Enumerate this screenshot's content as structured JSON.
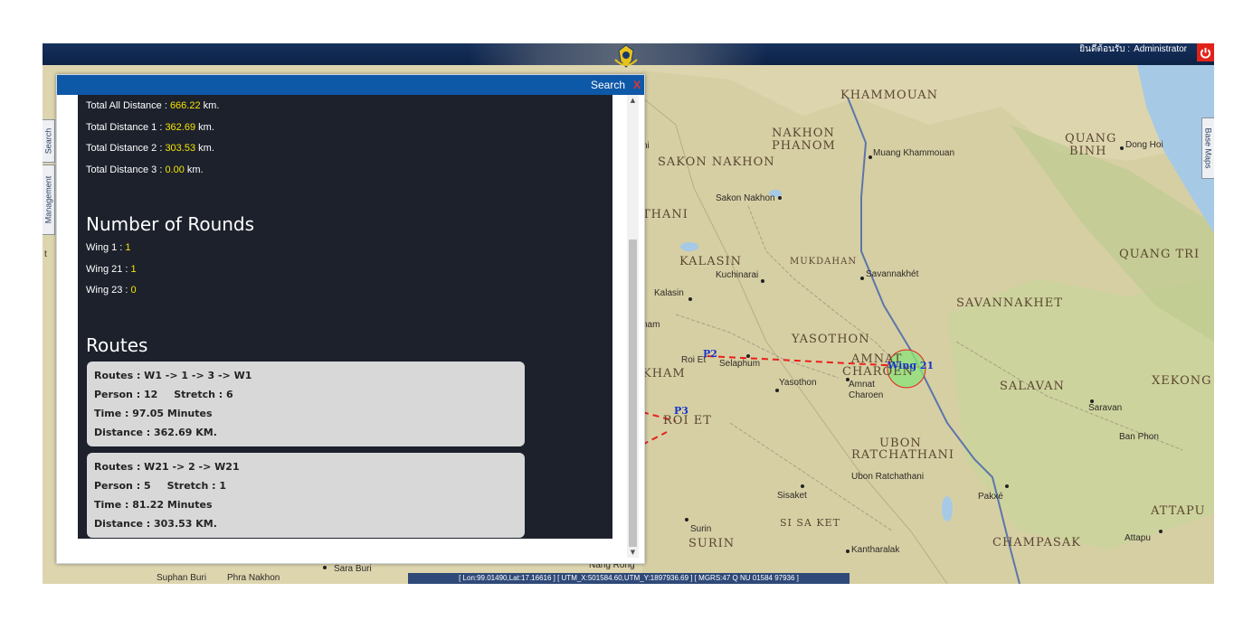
{
  "header": {
    "welcome": "ยินดีต้อนรับ :",
    "user": "Administrator"
  },
  "sidebar": {
    "left_tabs": [
      "Search",
      "Management"
    ],
    "right_tab": "Base Maps"
  },
  "panel": {
    "title": "Search",
    "close": "X",
    "distances": [
      {
        "label": "Total All Distance : ",
        "value": "666.22",
        "unit": " km."
      },
      {
        "label": "Total Distance 1 : ",
        "value": "362.69",
        "unit": " km."
      },
      {
        "label": "Total Distance 2 : ",
        "value": "303.53",
        "unit": " km."
      },
      {
        "label": "Total Distance 3 : ",
        "value": "0.00",
        "unit": " km."
      }
    ],
    "rounds_title": "Number of Rounds",
    "rounds": [
      {
        "label": "Wing 1 : ",
        "value": "1"
      },
      {
        "label": "Wing 21 : ",
        "value": "1"
      },
      {
        "label": "Wing 23 : ",
        "value": "0"
      }
    ],
    "routes_title": "Routes",
    "routes": [
      {
        "routes": "Routes : W1 -> 1 -> 3 -> W1",
        "person": "Person : 12",
        "stretch": "Stretch : 6",
        "time": "Time : 97.05 Minutes",
        "distance": "Distance : 362.69 KM."
      },
      {
        "routes": "Routes : W21 -> 2 -> W21",
        "person": "Person : 5",
        "stretch": "Stretch : 1",
        "time": "Time : 81.22 Minutes",
        "distance": "Distance : 303.53 KM."
      }
    ]
  },
  "map": {
    "regions": [
      "KHAMMOUAN",
      "NAKHON",
      "PHANOM",
      "SAKON NAKHON",
      "THANI",
      "KALASIN",
      "MUKDAHAN",
      "YASOTHON",
      "AMNAT",
      "CHAROEN",
      "SAVANNAKHET",
      "QUANG",
      "BINH",
      "QUANG TRI",
      "SALAVAN",
      "XEKONG",
      "ATTAPU",
      "CHAMPASAK",
      "UBON",
      "RATCHATHANI",
      "SI SA KET",
      "SURIN",
      "ROI ET",
      "KHAM"
    ],
    "cities": [
      "Muang Khammouan",
      "Dong Hoi",
      "Sakon Nakhon",
      "Kuchinarai",
      "Kalasin",
      "Savannakhét",
      "Selaphum",
      "Roi Et",
      "Yasothon",
      "Amnat",
      "Charoen",
      "Saravan",
      "Ban Phon",
      "Ubon Ratchathani",
      "Pakxé",
      "Sisaket",
      "Surin",
      "Kantharalak",
      "Attapu",
      "Nang Rong",
      "Suphan Buri",
      "Phra Nakhon",
      "Sara Buri",
      "ni",
      "nam",
      "t"
    ],
    "route_labels": [
      "P2",
      "P3",
      "Wing 21"
    ],
    "route_color": "#e8201c",
    "wing_fill": "#8fe07a"
  },
  "status_bar": "[ Lon:99.01490,Lat:17.16616 ] [ UTM_X:501584.60,UTM_Y:1897936.69 ] [ MGRS:47 Q NU 01584 97936 ]"
}
